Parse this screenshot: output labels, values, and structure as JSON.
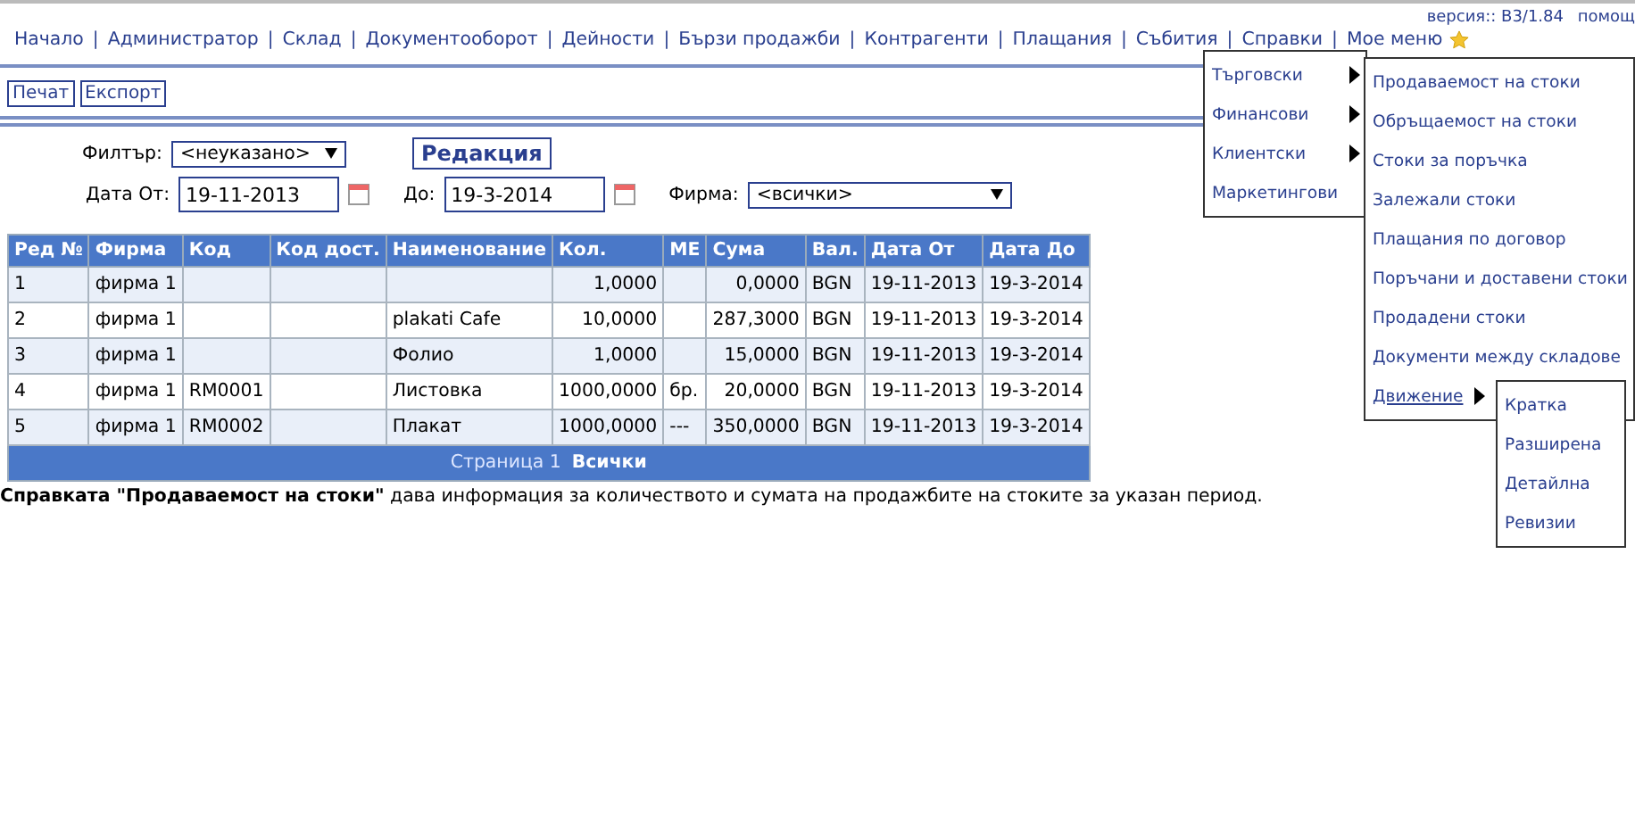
{
  "nav": {
    "items": [
      "Начало",
      "Администратор",
      "Склад",
      "Документооборот",
      "Дейности",
      "Бързи продажби",
      "Контрагенти",
      "Плащания",
      "Събития",
      "Справки",
      "Мое меню"
    ],
    "separator": "|",
    "version": "версия:: B3/1.84",
    "help": "помощ"
  },
  "toolbar": {
    "buttons": [
      "Печат",
      "Експорт"
    ]
  },
  "filter": {
    "label": "Филтър:",
    "value": "<неуказано>",
    "edit_button": "Редакция"
  },
  "dates": {
    "from_label": "Дата От:",
    "from": "19-11-2013",
    "to_label": "До:",
    "to": "19-3-2014",
    "firm_label": "Фирма:",
    "firm": "<всички>"
  },
  "table": {
    "columns": [
      {
        "label": "Ред №",
        "kind": "text"
      },
      {
        "label": "Фирма",
        "kind": "text"
      },
      {
        "label": "Код",
        "kind": "text"
      },
      {
        "label": "Код дост.",
        "kind": "text"
      },
      {
        "label": "Наименование",
        "kind": "text"
      },
      {
        "label": "Кол.",
        "kind": "number"
      },
      {
        "label": "МЕ",
        "kind": "text"
      },
      {
        "label": "Сума",
        "kind": "number"
      },
      {
        "label": "Вал.",
        "kind": "text"
      },
      {
        "label": "Дата От",
        "kind": "text"
      },
      {
        "label": "Дата До",
        "kind": "text"
      }
    ],
    "rows": [
      [
        "1",
        "фирма 1",
        "",
        "",
        "",
        "1,0000",
        "",
        "0,0000",
        "BGN",
        "19-11-2013",
        "19-3-2014"
      ],
      [
        "2",
        "фирма 1",
        "",
        "",
        "plakati Cafe",
        "10,0000",
        "",
        "287,3000",
        "BGN",
        "19-11-2013",
        "19-3-2014"
      ],
      [
        "3",
        "фирма 1",
        "",
        "",
        "Фолио",
        "1,0000",
        "",
        "15,0000",
        "BGN",
        "19-11-2013",
        "19-3-2014"
      ],
      [
        "4",
        "фирма 1",
        "RM0001",
        "",
        "Листовка",
        "1000,0000",
        "бр.",
        "20,0000",
        "BGN",
        "19-11-2013",
        "19-3-2014"
      ],
      [
        "5",
        "фирма 1",
        "RM0002",
        "",
        "Плакат",
        "1000,0000",
        "---",
        "350,0000",
        "BGN",
        "19-11-2013",
        "19-3-2014"
      ]
    ],
    "pager": {
      "label": "Страница",
      "page": "1",
      "all": "Всички"
    }
  },
  "description": "**Справката \"Продаваемост на стоки\"** дава информация за количеството и сумата на продажбите на стоките за указан период.",
  "menu": {
    "items": [
      {
        "label": "Търговски",
        "has_submenu": true
      },
      {
        "label": "Финансови",
        "has_submenu": true
      },
      {
        "label": "Клиентски",
        "has_submenu": true
      },
      {
        "label": "Маркетингови",
        "has_submenu": false
      }
    ],
    "submenu": [
      {
        "label": "Продаваемост на стоки",
        "has_submenu": false,
        "expanded": false
      },
      {
        "label": "Обръщаемост на стоки",
        "has_submenu": false,
        "expanded": false
      },
      {
        "label": "Стоки за поръчка",
        "has_submenu": false,
        "expanded": false
      },
      {
        "label": "Залежали стоки",
        "has_submenu": false,
        "expanded": false
      },
      {
        "label": "Плащания по договор",
        "has_submenu": false,
        "expanded": false
      },
      {
        "label": "Поръчани и доставени стоки",
        "has_submenu": false,
        "expanded": false
      },
      {
        "label": "Продадени стоки",
        "has_submenu": false,
        "expanded": false
      },
      {
        "label": "Документи между складове",
        "has_submenu": false,
        "expanded": false
      },
      {
        "label": "Движение",
        "has_submenu": true,
        "expanded": true
      }
    ],
    "subsubmenu": [
      "Кратка",
      "Разширена",
      "Детайлна",
      "Ревизии"
    ]
  }
}
